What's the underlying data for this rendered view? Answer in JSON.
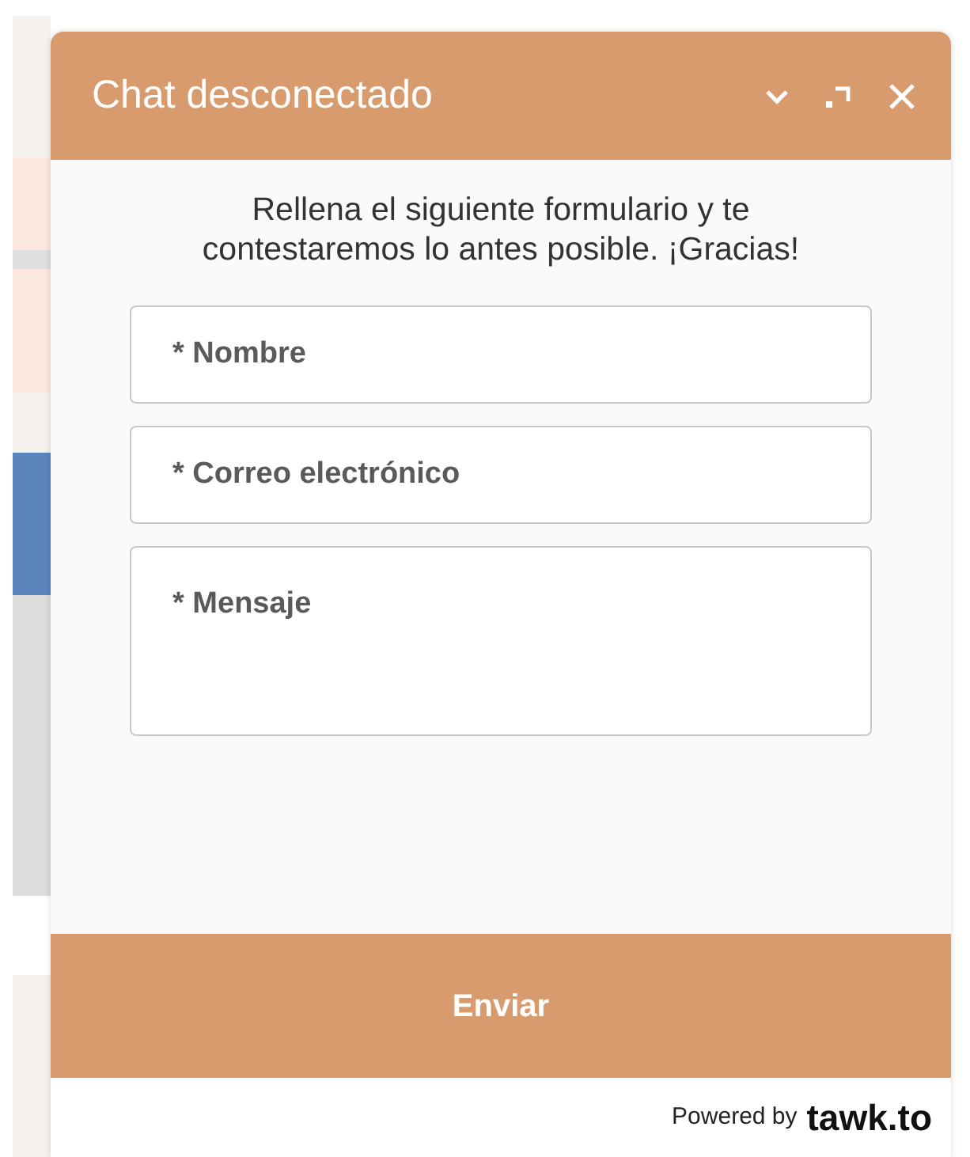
{
  "header": {
    "title": "Chat desconectado"
  },
  "intro": "Rellena el siguiente formulario y te contestaremos lo antes posible. ¡Gracias!",
  "fields": [
    {
      "kind": "input",
      "placeholder": "* Nombre"
    },
    {
      "kind": "input",
      "placeholder": "* Correo electrónico"
    },
    {
      "kind": "textarea",
      "placeholder": "* Mensaje"
    }
  ],
  "submit": "Enviar",
  "footer": {
    "powered_by": "Powered by",
    "brand": "tawk.to"
  }
}
